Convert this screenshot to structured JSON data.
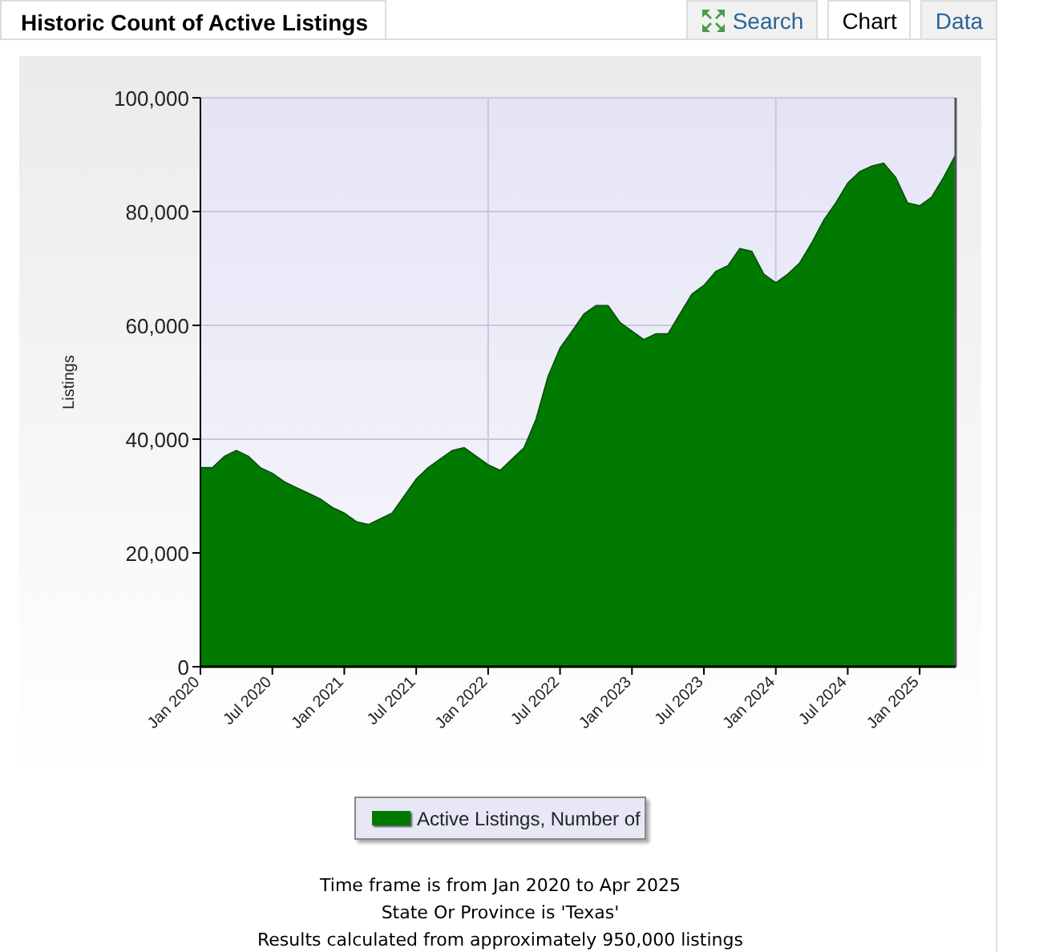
{
  "title": "Historic Count of Active Listings",
  "tabs": [
    {
      "label": "Search",
      "selected": false,
      "kind": "icon"
    },
    {
      "label": "Chart",
      "selected": true,
      "kind": "plain"
    },
    {
      "label": "Data",
      "selected": false,
      "kind": "plain"
    }
  ],
  "chart_data": {
    "type": "area",
    "ylabel": "Listings",
    "categories": [
      "Jan 2020",
      null,
      null,
      null,
      null,
      null,
      "Jul 2020",
      null,
      null,
      null,
      null,
      null,
      "Jan 2021",
      null,
      null,
      null,
      null,
      null,
      "Jul 2021",
      null,
      null,
      null,
      null,
      null,
      "Jan 2022",
      null,
      null,
      null,
      null,
      null,
      "Jul 2022",
      null,
      null,
      null,
      null,
      null,
      "Jan 2023",
      null,
      null,
      null,
      null,
      null,
      "Jul 2023",
      null,
      null,
      null,
      null,
      null,
      "Jan 2024",
      null,
      null,
      null,
      null,
      null,
      "Jul 2024",
      null,
      null,
      null,
      null,
      null,
      "Jan 2025",
      null,
      null,
      null
    ],
    "series": [
      {
        "name": "Active Listings, Number of",
        "color": "#007a00",
        "values": [
          35000,
          35000,
          37000,
          38000,
          37000,
          35000,
          34000,
          32500,
          31500,
          30500,
          29500,
          28000,
          27000,
          25500,
          25000,
          26000,
          27000,
          30000,
          33000,
          35000,
          36500,
          38000,
          38500,
          37000,
          35500,
          34500,
          36500,
          38500,
          43500,
          51000,
          56000,
          59000,
          62000,
          63500,
          63500,
          60500,
          59000,
          57500,
          58500,
          58500,
          62000,
          65500,
          67000,
          69500,
          70500,
          73500,
          73000,
          69000,
          67500,
          69000,
          71000,
          74500,
          78500,
          81500,
          85000,
          87000,
          88000,
          88500,
          86000,
          81500,
          81000,
          82500,
          86000,
          90000
        ]
      }
    ],
    "ylim": [
      0,
      100000
    ],
    "grid": true,
    "yticks": [
      {
        "value": 0,
        "label": "0"
      },
      {
        "value": 20000,
        "label": "20,000"
      },
      {
        "value": 40000,
        "label": "40,000"
      },
      {
        "value": 60000,
        "label": "60,000"
      },
      {
        "value": 80000,
        "label": "80,000"
      },
      {
        "value": 100000,
        "label": "100,000"
      }
    ]
  },
  "notes": [
    "Time frame is from Jan 2020 to Apr 2025",
    "State Or Province is 'Texas'",
    "Results calculated from approximately 950,000 listings"
  ]
}
